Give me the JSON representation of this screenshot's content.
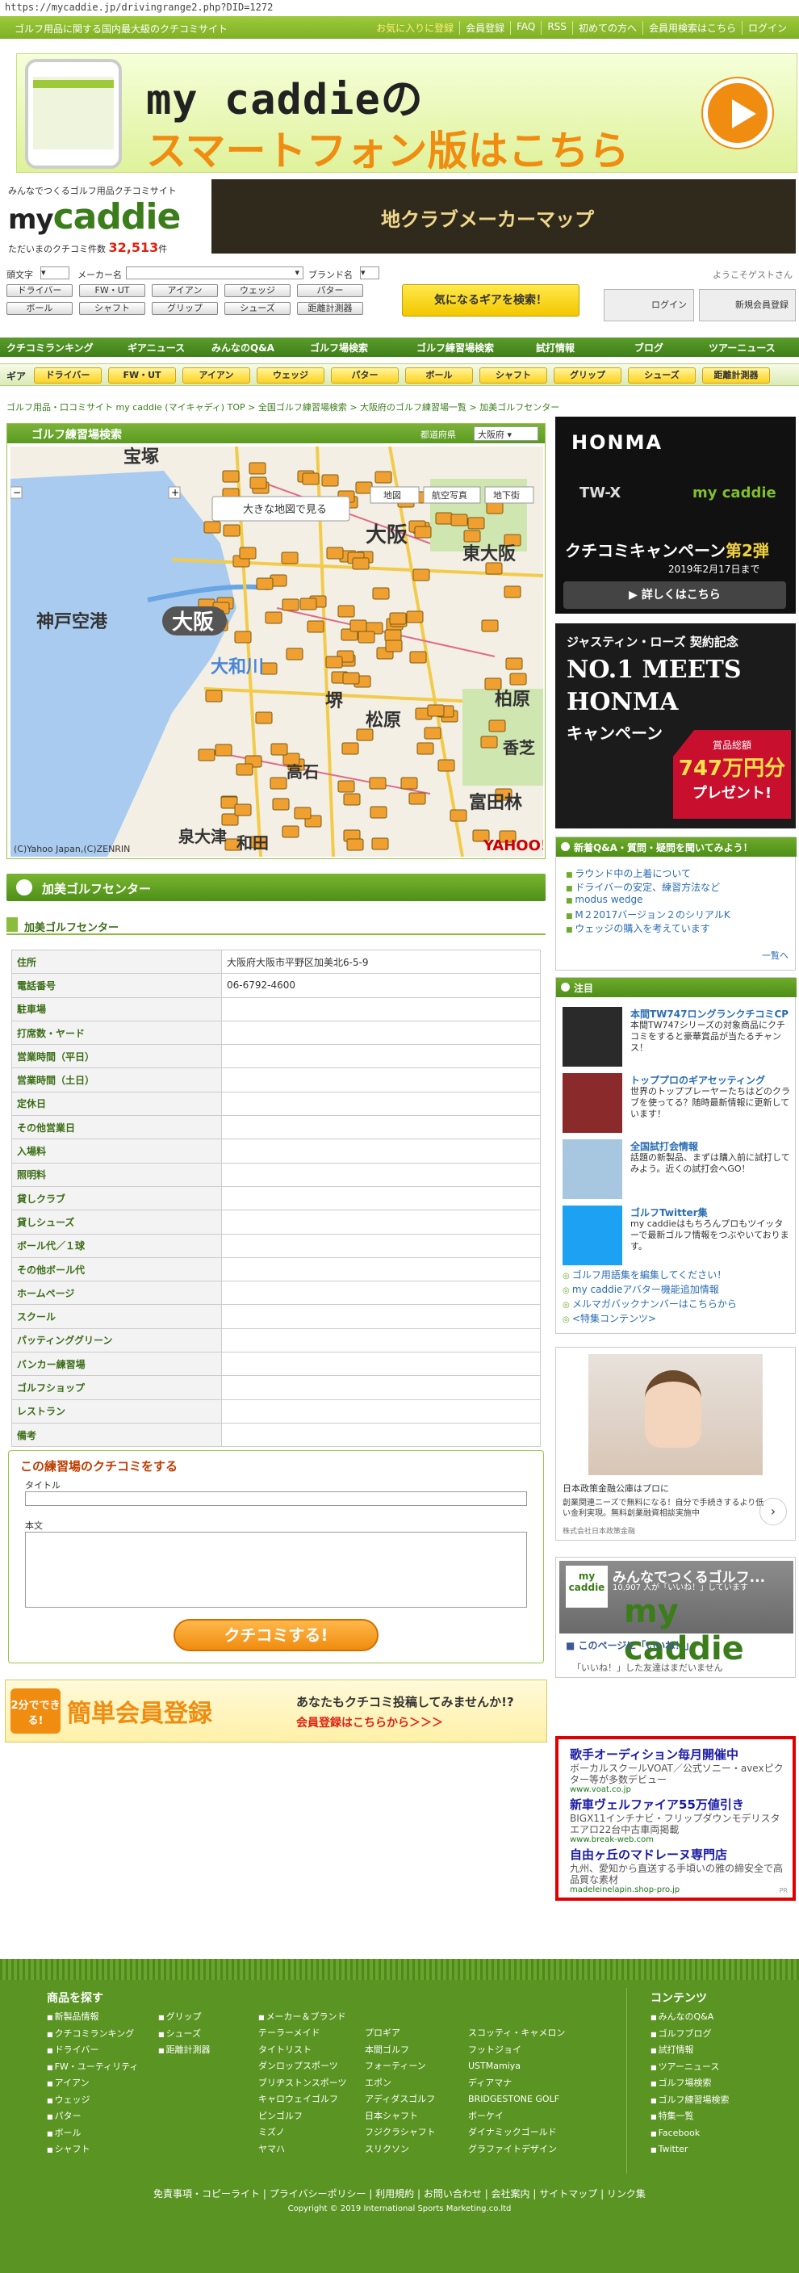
{
  "url": "https://mycaddie.jp/drivingrange2.php?DID=1272",
  "topbar": {
    "site_desc": "ゴルフ用品に関する国内最大級のクチコミサイト",
    "links": [
      "お気に入りに登録",
      "会員登録",
      "FAQ",
      "RSS",
      "初めての方へ",
      "会員用検索はこちら",
      "ログイン"
    ]
  },
  "banner": {
    "title": "my caddieの",
    "subtitle": "スマートフォン版はこちら"
  },
  "logo": {
    "tagline": "みんなでつくるゴルフ用品クチコミサイト",
    "mark_my": "my",
    "mark_caddie": "caddie",
    "count_label": "ただいまのクチコミ件数",
    "count_value": "32,513",
    "count_unit": "件"
  },
  "maker_map_banner": "地クラブメーカーマップ",
  "search": {
    "initial_label": "頭文字",
    "maker_label": "メーカー名",
    "brand_label": "ブランド名",
    "categories": [
      "ドライバー",
      "FW・UT",
      "アイアン",
      "ウェッジ",
      "パター",
      "ボール",
      "シャフト",
      "グリップ",
      "シューズ",
      "距離計測器"
    ],
    "search_button": "気になるギアを検索！",
    "guest": "ようこそゲストさん",
    "login": "ログイン",
    "register": "新規会員登録"
  },
  "nav_main": [
    "クチコミランキング",
    "ギアニュース",
    "みんなのQ&A",
    "ゴルフ場検索",
    "ゴルフ練習場検索",
    "試打情報",
    "ブログ",
    "ツアーニュース"
  ],
  "nav_gear": {
    "label": "ギア",
    "items": [
      "ドライバー",
      "FW・UT",
      "アイアン",
      "ウェッジ",
      "パター",
      "ボール",
      "シャフト",
      "グリップ",
      "シューズ",
      "距離計測器"
    ]
  },
  "breadcrumb": "ゴルフ用品・口コミサイト my caddie (マイキャディ) TOP > 全国ゴルフ練習場検索 > 大阪府のゴルフ練習場一覧 > 加美ゴルフセンター",
  "map": {
    "header": "ゴルフ練習場検索",
    "pref_label": "都道府県",
    "pref_value": "大阪府",
    "big_map_btn": "大きな地図で見る",
    "map_types": [
      "地図",
      "航空写真",
      "地下街"
    ],
    "labels": [
      "大阪",
      "東大阪",
      "神戸空港",
      "大阪",
      "大和川",
      "堺",
      "松原",
      "柏原",
      "香芝",
      "高石",
      "富田林",
      "泉大津",
      "和田",
      "宝塚"
    ],
    "copyright": "(C)Yahoo Japan,(C)ZENRIN",
    "logo": "YAHOO!"
  },
  "range_title": "加美ゴルフセンター",
  "range_subtitle": "加美ゴルフセンター",
  "info_rows": [
    {
      "k": "住所",
      "v": "大阪府大阪市平野区加美北6-5-9"
    },
    {
      "k": "電話番号",
      "v": "06-6792-4600"
    },
    {
      "k": "駐車場",
      "v": ""
    },
    {
      "k": "打席数・ヤード",
      "v": ""
    },
    {
      "k": "営業時間（平日）",
      "v": ""
    },
    {
      "k": "営業時間（土日）",
      "v": ""
    },
    {
      "k": "定休日",
      "v": ""
    },
    {
      "k": "その他営業日",
      "v": ""
    },
    {
      "k": "入場料",
      "v": ""
    },
    {
      "k": "照明料",
      "v": ""
    },
    {
      "k": "貸しクラブ",
      "v": ""
    },
    {
      "k": "貸しシューズ",
      "v": ""
    },
    {
      "k": "ボール代／１球",
      "v": ""
    },
    {
      "k": "その他ボール代",
      "v": ""
    },
    {
      "k": "ホームページ",
      "v": ""
    },
    {
      "k": "スクール",
      "v": ""
    },
    {
      "k": "パッティンググリーン",
      "v": ""
    },
    {
      "k": "バンカー練習場",
      "v": ""
    },
    {
      "k": "ゴルフショップ",
      "v": ""
    },
    {
      "k": "レストラン",
      "v": ""
    },
    {
      "k": "備考",
      "v": ""
    }
  ],
  "review": {
    "title": "この練習場のクチコミをする",
    "title_label": "タイトル",
    "body_label": "本文",
    "submit": "クチコミする!"
  },
  "register_banner": {
    "badge": "2分でできる!",
    "big": "簡単会員登録",
    "question": "あなたもクチコミ投稿してみませんか!?",
    "action": "会員登録はこちらから＞＞＞"
  },
  "ad_honma": {
    "brand": "HONMA",
    "product": "TW-X",
    "partner": "my caddie",
    "campaign": "クチコミキャンペーン",
    "campaign_no": "第2弾",
    "date": "2019年2月17日まで",
    "more": "詳しくはこちら"
  },
  "ad_rose": {
    "line1": "ジャスティン・ローズ 契約記念",
    "line2": "NO.1 MEETS",
    "line3": "HONMA",
    "line4": "キャンペーン",
    "prize_label": "賞品総額",
    "prize_value": "747万円分",
    "prize_note": "プレゼント!"
  },
  "qa": {
    "header": "新着Q&A・質問・疑問を聞いてみよう！",
    "items": [
      "ラウンド中の上着について",
      "ドライバーの安定、練習方法など",
      "modus wedge",
      "M２2017バージョン２のシリアルK",
      "ウェッジの購入を考えています"
    ],
    "all": "一覧へ"
  },
  "notice": {
    "header": "注目",
    "items": [
      {
        "title": "本間TW747ロングランクチコミCP",
        "desc": "本間TW747シリーズの対象商品にクチコミをすると豪華賞品が当たるチャンス！"
      },
      {
        "title": "トッププロのギアセッティング",
        "desc": "世界のトッププレーヤーたちはどのクラブを使ってる？随時最新情報に更新しています！"
      },
      {
        "title": "全国試打会情報",
        "desc": "話題の新製品、まずは購入前に試打してみよう。近くの試打会へGO！"
      },
      {
        "title": "ゴルフTwitter集",
        "desc": "my caddieはもちろんプロもツイッターで最新ゴルフ情報をつぶやいております。"
      }
    ],
    "links": [
      "ゴルフ用語集を編集してください！",
      "my caddieアバター機能追加情報",
      "メルマガバックナンバーはこちらから",
      "<特集コンテンツ>"
    ]
  },
  "ad_photo": {
    "caption": "日本政策金融公庫はプロに",
    "desc": "創業関連ニーズで無料になる！自分で手続きするより低い金利実現。無料創業融資相談実施中",
    "sponsor": "株式会社日本政策金融"
  },
  "fb": {
    "title": "みんなでつくるゴルフ...",
    "likes": "10,907 人が「いいね！」しています",
    "brand": "my caddie",
    "box_logo": "my caddie",
    "like_label": "このページに「いいね！」",
    "none": "「いいね！」した友達はまだいません"
  },
  "text_ads": [
    {
      "h": "歌手オーディション毎月開催中",
      "d": "ボーカルスクールVOAT／公式ソニー・avexピクター等が多数デビュー",
      "u": "www.voat.co.jp"
    },
    {
      "h": "新車ヴェルファイア55万値引き",
      "d": "BIGX11インチナビ・フリップダウンモデリスタエアロ22台中古車両掲載",
      "u": "www.break-web.com"
    },
    {
      "h": "自由ヶ丘のマドレーヌ専門店",
      "d": "九州、愛知から直送する手頃いの雅の締安全で高品質な素材",
      "u": "madeleinelapin.shop-pro.jp"
    }
  ],
  "text_ads_tag": "PR",
  "footer": {
    "products_header": "商品を探す",
    "col1": [
      "新製品情報",
      "クチコミランキング",
      "ドライバー",
      "FW・ユーティリティ",
      "アイアン",
      "ウェッジ",
      "パター",
      "ボール",
      "シャフト"
    ],
    "col2": [
      "グリップ",
      "シューズ",
      "距離計測器"
    ],
    "col3_head": "メーカー＆ブランド",
    "col3": [
      "テーラーメイド",
      "タイトリスト",
      "ダンロップスポーツ",
      "ブリヂストンスポーツ",
      "キャロウェイゴルフ",
      "ピンゴルフ",
      "ミズノ",
      "ヤマハ"
    ],
    "col4": [
      "プロギア",
      "本間ゴルフ",
      "フォーティーン",
      "エポン",
      "アディダスゴルフ",
      "日本シャフト",
      "フジクラシャフト",
      "スリクソン"
    ],
    "col5": [
      "スコッティ・キャメロン",
      "フットジョイ",
      "USTMamiya",
      "ディアマナ",
      "BRIDGESTONE GOLF",
      "ボーケイ",
      "ダイナミックゴールド",
      "グラファイトデザイン"
    ],
    "contents_header": "コンテンツ",
    "col6": [
      "みんなのQ&A",
      "ゴルフブログ",
      "試打情報",
      "ツアーニュース",
      "ゴルフ場検索",
      "ゴルフ練習場検索",
      "特集一覧",
      "Facebook",
      "Twitter"
    ],
    "bottom_links": [
      "免責事項・コピーライト",
      "プライバシーポリシー",
      "利用規約",
      "お問い合わせ",
      "会社案内",
      "サイトマップ",
      "リンク集"
    ],
    "copyright": "Copyright © 2019 International Sports Marketing.co.ltd"
  }
}
